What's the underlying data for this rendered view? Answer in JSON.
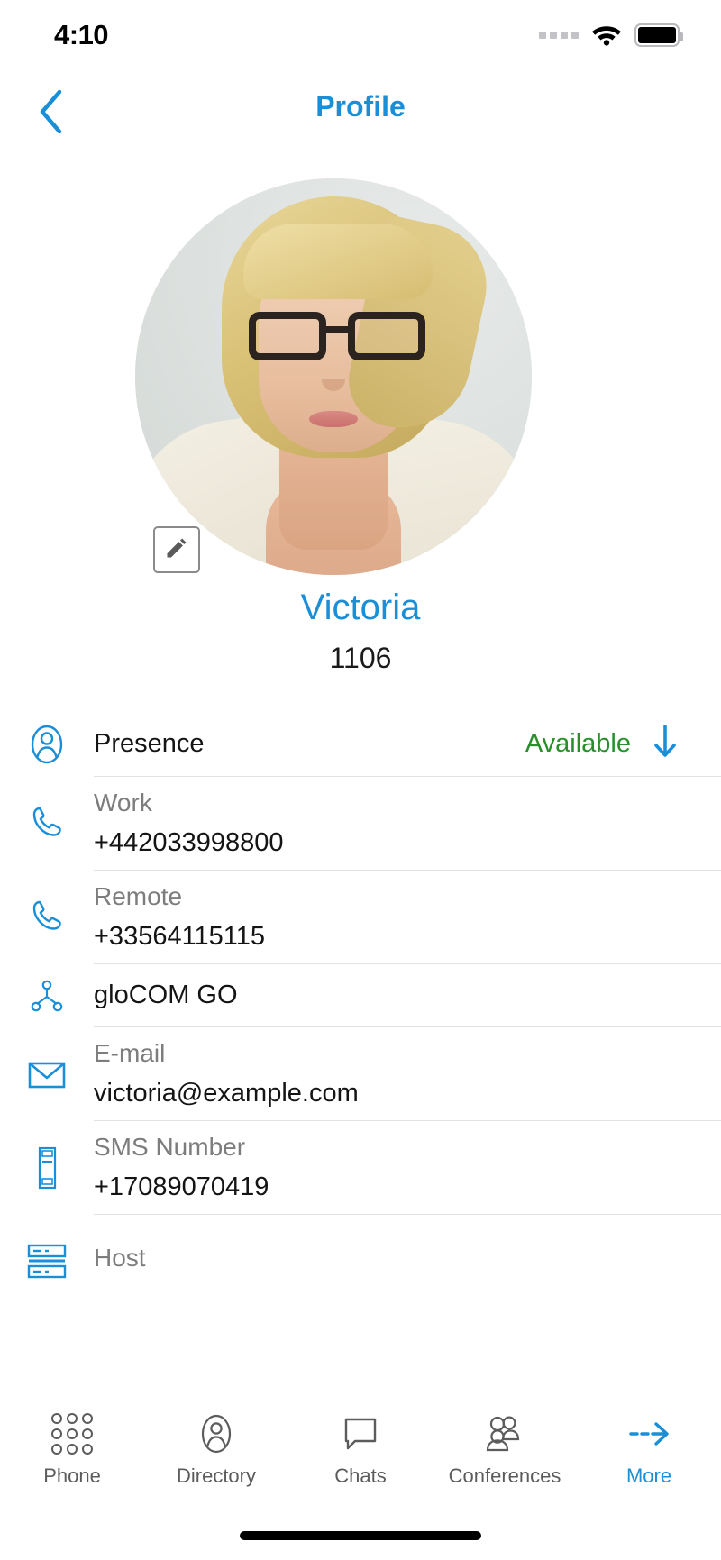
{
  "status_bar": {
    "time": "4:10",
    "signal_icon": "signal-dots-icon",
    "wifi_icon": "wifi-icon",
    "battery_icon": "battery-full-icon"
  },
  "nav": {
    "back_icon": "chevron-left-icon",
    "title": "Profile"
  },
  "avatar": {
    "name": "profile-photo",
    "edit_icon": "pencil-edit-icon"
  },
  "identity": {
    "name": "Victoria",
    "extension": "1106"
  },
  "colors": {
    "accent_blue": "#1a8fd8",
    "available_green": "#2a8f2a",
    "label_gray": "#7d7d7d",
    "value_black": "#141414",
    "divider": "#e2e2e2"
  },
  "details": [
    {
      "icon": "user-presence-icon",
      "layout": "single",
      "label": "Presence",
      "value": "Available",
      "value_color": "#2a8f2a",
      "trailing_icon": "arrow-down-icon"
    },
    {
      "icon": "phone-handset-icon",
      "layout": "stacked",
      "label": "Work",
      "value": "+442033998800"
    },
    {
      "icon": "phone-handset-icon",
      "layout": "stacked",
      "label": "Remote",
      "value": "+33564115115"
    },
    {
      "icon": "network-nodes-icon",
      "layout": "single",
      "label": "gloCOM GO",
      "value": ""
    },
    {
      "icon": "envelope-icon",
      "layout": "stacked",
      "label": "E-mail",
      "value": "victoria@example.com"
    },
    {
      "icon": "mobile-phone-icon",
      "layout": "stacked",
      "label": "SMS Number",
      "value": "+17089070419"
    },
    {
      "icon": "server-rack-icon",
      "layout": "stacked",
      "label": "Host",
      "value": ""
    }
  ],
  "tab_bar": {
    "active_index": 4,
    "tabs": [
      {
        "label": "Phone",
        "icon": "dialpad-icon"
      },
      {
        "label": "Directory",
        "icon": "person-oval-icon"
      },
      {
        "label": "Chats",
        "icon": "speech-bubble-icon"
      },
      {
        "label": "Conferences",
        "icon": "group-people-icon"
      },
      {
        "label": "More",
        "icon": "dashed-arrow-right-icon"
      }
    ]
  },
  "home_indicator": "home-bar"
}
